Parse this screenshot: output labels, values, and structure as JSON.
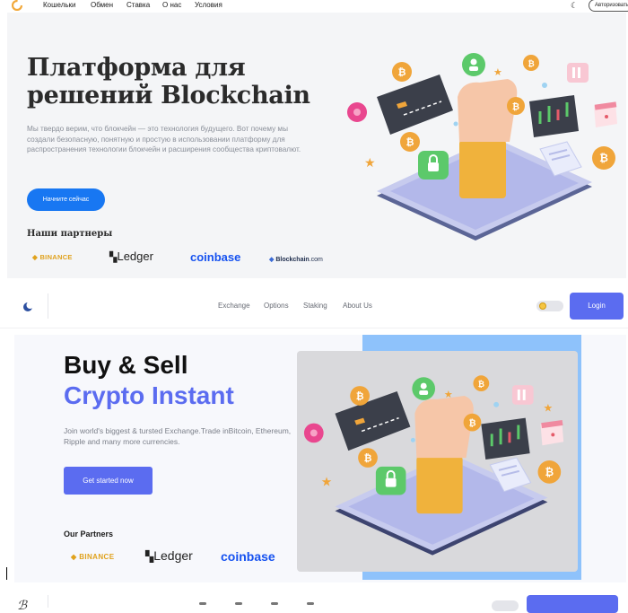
{
  "section1": {
    "nav": [
      "Кошельки",
      "Обмен",
      "Ставка",
      "О нас",
      "Условия"
    ],
    "auth_label": "Авторизоваться",
    "title_line1": "Платформа для",
    "title_line2": "решений Blockchain",
    "description": "Мы твердо верим, что блокчейн — это технология будущего. Вот почему мы создали безопасную, понятную и простую в использовании платформу для распространения технологии блокчейн и расширения сообщества криптовалют.",
    "cta": "Начните сейчас",
    "partners_heading": "Наши партнеры",
    "partners": [
      "BINANCE",
      "Ledger",
      "coinbase",
      "Blockchain",
      ".com"
    ]
  },
  "section2": {
    "nav": [
      "Exchange",
      "Options",
      "Staking",
      "About Us"
    ],
    "login": "Login",
    "title_line1": "Buy & Sell",
    "title_line2": "Crypto Instant",
    "description": "Join world's biggest & tursted Exchange.Trade inBitcoin, Ethereum, Ripple and many more currencies.",
    "cta": "Get started now",
    "partners_heading": "Our Partners",
    "partners": [
      "BINANCE",
      "Ledger",
      "coinbase"
    ]
  },
  "colors": {
    "accent_blue_s1": "#1877f2",
    "accent_indigo_s2": "#5b6cf0",
    "hero_bg": "#f4f5f7",
    "panel_blue": "#8ec2fb",
    "coin_orange": "#f0a53a"
  },
  "icons": [
    "logo-icon",
    "moon-icon",
    "toggle-icon",
    "binance-icon",
    "ledger-icon",
    "blockchain-icon",
    "bitcoin-coin-icon",
    "lock-icon",
    "card-icon",
    "chart-icon",
    "calendar-icon",
    "gear-icon",
    "star-icon"
  ]
}
